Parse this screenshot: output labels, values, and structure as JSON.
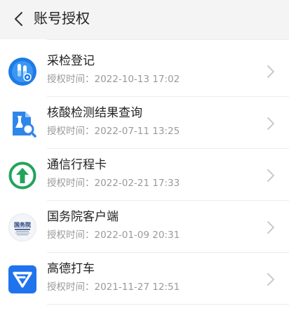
{
  "header": {
    "title": "账号授权"
  },
  "auth_label": "授权时间：",
  "items": [
    {
      "name": "采检登记",
      "time": "2022-10-13 17:02",
      "icon": "test-tube-icon"
    },
    {
      "name": "核酸检测结果查询",
      "time": "2022-07-11 13:25",
      "icon": "document-search-icon"
    },
    {
      "name": "通信行程卡",
      "time": "2022-02-21 17:33",
      "icon": "up-arrow-circle-icon"
    },
    {
      "name": "国务院客户端",
      "time": "2022-01-09 20:31",
      "icon": "state-council-logo-icon",
      "icon_text": "国务院"
    },
    {
      "name": "高德打车",
      "time": "2021-11-27 12:51",
      "icon": "amap-taxi-icon"
    }
  ]
}
